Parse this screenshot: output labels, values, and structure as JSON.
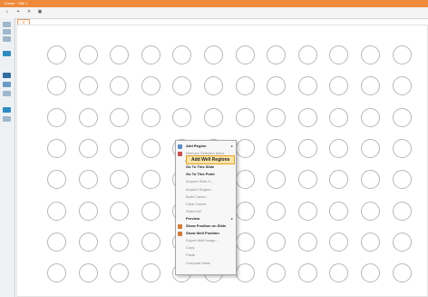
{
  "window": {
    "title": "Trainer · Site 1"
  },
  "toolbar": {
    "buttons": [
      "⌂",
      "⌖",
      "✕",
      "▣"
    ]
  },
  "tab": {
    "label": "1"
  },
  "grid": {
    "rows": 8,
    "cols": 12
  },
  "context_menu": {
    "items": [
      {
        "label": "Add Region",
        "has_submenu": true,
        "enabled": true,
        "icon": "region-icon"
      },
      {
        "label": "Remove Selected Items",
        "has_submenu": false,
        "enabled": false,
        "icon": "remove-icon"
      },
      {
        "label": "",
        "separator": true
      },
      {
        "label": "Go To This Slide",
        "has_submenu": false,
        "enabled": true
      },
      {
        "label": "Go To This Point",
        "has_submenu": false,
        "enabled": true
      },
      {
        "label": "Acquire Slide Z...",
        "has_submenu": false,
        "enabled": false
      },
      {
        "label": "Acquire Region...",
        "has_submenu": false,
        "enabled": false
      },
      {
        "label": "Build Cache...",
        "has_submenu": false,
        "enabled": false
      },
      {
        "label": "Clear Cache...",
        "has_submenu": false,
        "enabled": false
      },
      {
        "label": "Select All",
        "has_submenu": false,
        "enabled": false
      },
      {
        "label": "Preview",
        "has_submenu": true,
        "enabled": true
      },
      {
        "label": "Show Position on Slide",
        "has_submenu": false,
        "enabled": true,
        "icon": "slide-position-icon"
      },
      {
        "label": "Show Well Position",
        "has_submenu": false,
        "enabled": true,
        "icon": "well-position-icon"
      },
      {
        "label": "Export Well Image...",
        "has_submenu": false,
        "enabled": false
      },
      {
        "label": "Copy",
        "has_submenu": false,
        "enabled": false
      },
      {
        "label": "Paste",
        "has_submenu": false,
        "enabled": false
      },
      {
        "label": "Compute Mask",
        "has_submenu": false,
        "enabled": false
      }
    ]
  },
  "submenu": {
    "highlighted_label": "Add Well Regions"
  },
  "colors": {
    "accent": "#ee8a3a",
    "highlight": "#fde4a6",
    "well_border": "#b7b7b7"
  }
}
